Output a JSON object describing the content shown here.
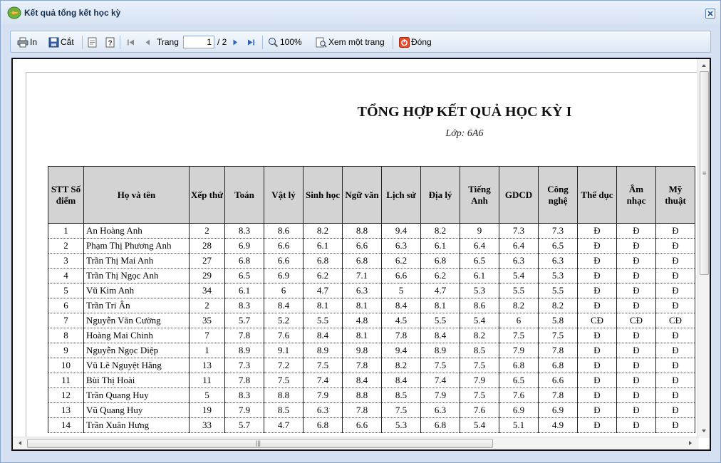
{
  "window": {
    "title": "Kết quả tổng kết học kỳ"
  },
  "toolbar": {
    "print_label": "In",
    "save_label": "Cắt",
    "page_label": "Trang",
    "page_current": "1",
    "page_total": "/ 2",
    "zoom_label": "100%",
    "single_page_label": "Xem một trang",
    "close_label": "Đóng"
  },
  "report": {
    "title": "TỔNG HỢP KẾT QUẢ HỌC KỲ I",
    "subtitle": "Lớp: 6A6",
    "columns": [
      "STT Số điểm",
      "Họ và tên",
      "Xếp thứ",
      "Toán",
      "Vật lý",
      "Sinh học",
      "Ngữ văn",
      "Lịch sử",
      "Địa lý",
      "Tiếng Anh",
      "GDCD",
      "Công nghệ",
      "Thể dục",
      "Âm nhạc",
      "Mỹ thuật"
    ],
    "rows": [
      [
        "1",
        "An Hoàng Anh",
        "2",
        "8.3",
        "8.6",
        "8.2",
        "8.8",
        "9.4",
        "8.2",
        "9",
        "7.3",
        "7.3",
        "Đ",
        "Đ",
        "Đ"
      ],
      [
        "2",
        "Phạm Thị Phương Anh",
        "28",
        "6.9",
        "6.6",
        "6.1",
        "6.6",
        "6.3",
        "6.1",
        "6.4",
        "6.4",
        "6.5",
        "Đ",
        "Đ",
        "Đ"
      ],
      [
        "3",
        "Trần Thị Mai Anh",
        "27",
        "6.8",
        "6.6",
        "6.8",
        "6.8",
        "6.2",
        "6.8",
        "6.5",
        "6.3",
        "6.3",
        "Đ",
        "Đ",
        "Đ"
      ],
      [
        "4",
        "Trần Thị Ngọc Anh",
        "29",
        "6.5",
        "6.9",
        "6.2",
        "7.1",
        "6.6",
        "6.2",
        "6.1",
        "5.4",
        "5.3",
        "Đ",
        "Đ",
        "Đ"
      ],
      [
        "5",
        "Vũ Kim Anh",
        "34",
        "6.1",
        "6",
        "4.7",
        "6.3",
        "5",
        "4.7",
        "5.3",
        "5.5",
        "5.5",
        "Đ",
        "Đ",
        "Đ"
      ],
      [
        "6",
        "Trần Tri Ân",
        "2",
        "8.3",
        "8.4",
        "8.1",
        "8.1",
        "8.4",
        "8.1",
        "8.6",
        "8.2",
        "8.2",
        "Đ",
        "Đ",
        "Đ"
      ],
      [
        "7",
        "Nguyễn Văn Cường",
        "35",
        "5.7",
        "5.2",
        "5.5",
        "4.8",
        "4.5",
        "5.5",
        "5.4",
        "6",
        "5.8",
        "CĐ",
        "CĐ",
        "CĐ"
      ],
      [
        "8",
        "Hoàng Mai Chinh",
        "7",
        "7.8",
        "7.6",
        "8.4",
        "8.1",
        "7.8",
        "8.4",
        "8.2",
        "7.5",
        "7.5",
        "Đ",
        "Đ",
        "Đ"
      ],
      [
        "9",
        "Nguyễn Ngọc Diệp",
        "1",
        "8.9",
        "9.1",
        "8.9",
        "9.8",
        "9.4",
        "8.9",
        "8.5",
        "7.9",
        "7.8",
        "Đ",
        "Đ",
        "Đ"
      ],
      [
        "10",
        "Vũ Lê Nguyệt Hằng",
        "13",
        "7.3",
        "7.2",
        "7.5",
        "7.8",
        "8.2",
        "7.5",
        "7.5",
        "6.8",
        "6.8",
        "Đ",
        "Đ",
        "Đ"
      ],
      [
        "11",
        "Bùi Thị Hoài",
        "11",
        "7.8",
        "7.5",
        "7.4",
        "8.4",
        "8.4",
        "7.4",
        "7.9",
        "6.5",
        "6.6",
        "Đ",
        "Đ",
        "Đ"
      ],
      [
        "12",
        "Trần Quang Huy",
        "5",
        "8.3",
        "8.8",
        "7.9",
        "8.8",
        "8.5",
        "7.9",
        "7.5",
        "7.6",
        "7.8",
        "Đ",
        "Đ",
        "Đ"
      ],
      [
        "13",
        "Vũ Quang Huy",
        "19",
        "7.9",
        "8.5",
        "6.3",
        "7.8",
        "7.5",
        "6.3",
        "7.6",
        "6.9",
        "6.9",
        "Đ",
        "Đ",
        "Đ"
      ],
      [
        "14",
        "Trần Xuân Hưng",
        "33",
        "5.7",
        "4.7",
        "6.8",
        "6.6",
        "5.3",
        "6.8",
        "5.4",
        "5.1",
        "4.9",
        "Đ",
        "Đ",
        "Đ"
      ]
    ]
  }
}
